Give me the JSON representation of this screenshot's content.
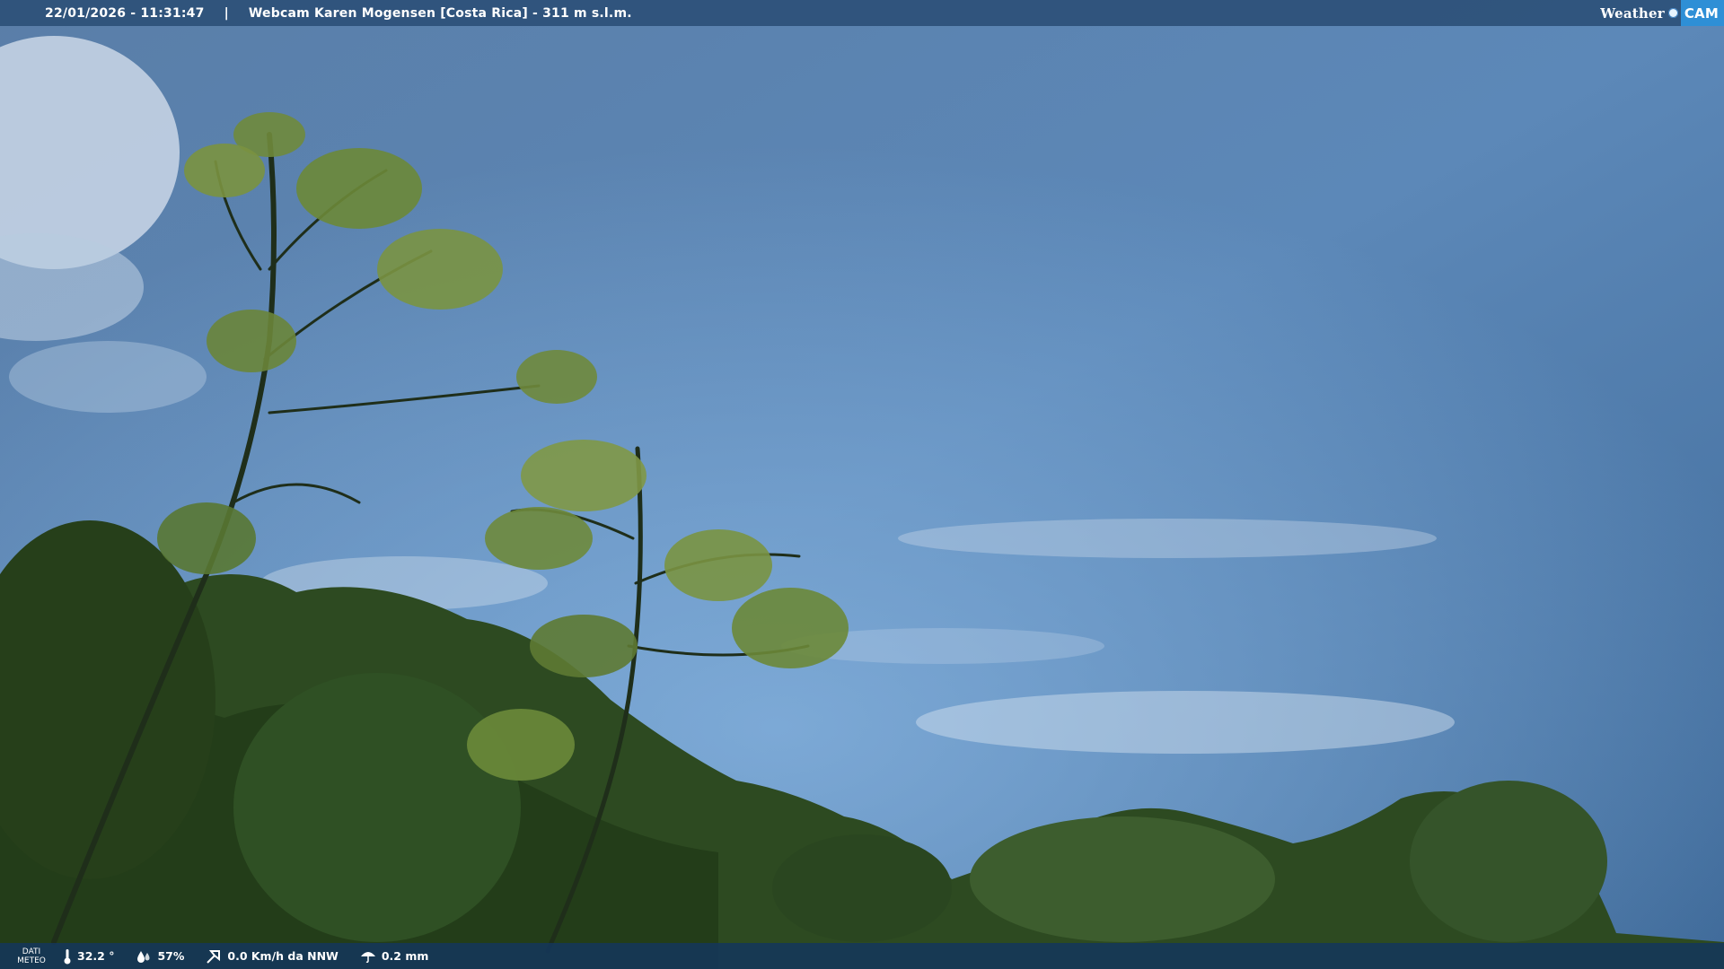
{
  "header": {
    "datetime": "22/01/2026 - 11:31:47",
    "separator": "|",
    "title": "Webcam Karen Mogensen [Costa Rica] - 311 m s.l.m."
  },
  "brand": {
    "weather": "Weather",
    "cam": "CAM"
  },
  "meteo": {
    "label_line1": "DATI",
    "label_line2": "METEO",
    "temperature": "32.2 °",
    "humidity": "57%",
    "wind": "0.0 Km/h da NNW",
    "rain": "0.2 mm"
  },
  "colors": {
    "sky_top": "#5c7fa6",
    "sky_bottom": "#6f9ccb",
    "foliage": "#2a4a1c",
    "accent": "#2e8fd6"
  }
}
